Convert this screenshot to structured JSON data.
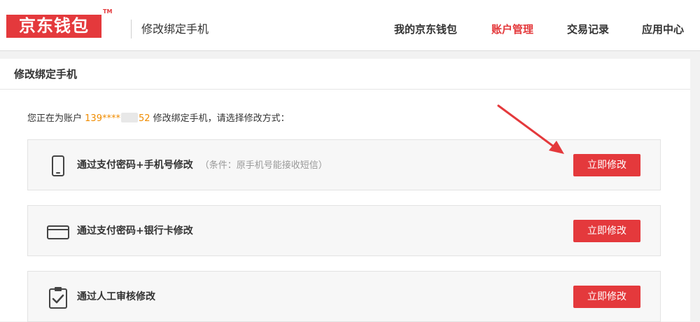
{
  "header": {
    "logo_text": "京东钱包",
    "logo_tm": "TM",
    "page_title": "修改绑定手机",
    "nav": [
      {
        "label": "我的京东钱包",
        "active": false
      },
      {
        "label": "账户管理",
        "active": true
      },
      {
        "label": "交易记录",
        "active": false
      },
      {
        "label": "应用中心",
        "active": false
      }
    ]
  },
  "panel": {
    "title": "修改绑定手机",
    "intro_prefix": "您正在为账户",
    "account_start": "139****",
    "account_end": "52",
    "intro_suffix": "修改绑定手机，请选择修改方式："
  },
  "options": [
    {
      "icon": "mobile-phone-icon",
      "label": "通过支付密码+手机号修改",
      "condition": "（条件：原手机号能接收短信）",
      "button": "立即修改"
    },
    {
      "icon": "bank-card-icon",
      "label": "通过支付密码+银行卡修改",
      "condition": "",
      "button": "立即修改"
    },
    {
      "icon": "clipboard-check-icon",
      "label": "通过人工审核修改",
      "condition": "",
      "button": "立即修改"
    }
  ],
  "colors": {
    "brand_red": "#e4393c",
    "account_orange": "#f08c00",
    "background": "#f2f2f2"
  }
}
